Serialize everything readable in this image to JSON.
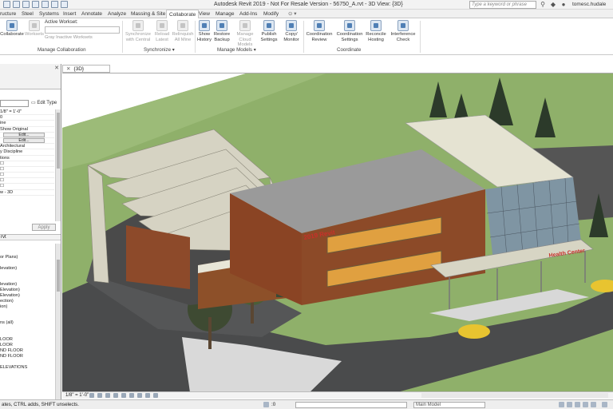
{
  "titlebar": {
    "title": "Autodesk Revit 2019 - Not For Resale Version - 56750_A.rvt - 3D View: {3D}",
    "search_placeholder": "Type a keyword or phrase",
    "user": "tomesc.hudale"
  },
  "tabs": [
    {
      "label": "ructure"
    },
    {
      "label": "Steel"
    },
    {
      "label": "Systems"
    },
    {
      "label": "Insert"
    },
    {
      "label": "Annotate"
    },
    {
      "label": "Analyze"
    },
    {
      "label": "Massing & Site"
    },
    {
      "label": "Collaborate"
    },
    {
      "label": "View"
    },
    {
      "label": "Manage"
    },
    {
      "label": "Add-Ins"
    },
    {
      "label": "Modify"
    }
  ],
  "ribbon": {
    "collaborate_label": "Collaborate",
    "worksets_label": "Worksets",
    "active_workset_label": "Active Workset:",
    "gray_inactive_label": "Gray Inactive Worksets",
    "manage_collab_label": "Manage Collaboration",
    "synchronize": {
      "sync_central": "Synchronize with Central",
      "reload_latest": "Reload Latest",
      "relinquish_all": "Relinquish All Mine",
      "panel": "Synchronize ▾"
    },
    "manage_models": {
      "show_history": "Show History",
      "restore_backup": "Restore Backup",
      "manage_cloud": "Manage Cloud Models",
      "publish_settings": "Publish Settings",
      "copy_monitor": "Copy/ Monitor",
      "panel": "Manage Models ▾"
    },
    "coordinate": {
      "coord_review": "Coordination Review",
      "coord_settings": "Coordination Settings",
      "reconcile": "Reconcile Hosting",
      "interference": "Interference Check",
      "panel": "Coordinate"
    }
  },
  "properties": {
    "edit_type": "Edit Type",
    "rows": [
      "1/8\" = 1'-0\"",
      "0",
      "ine",
      "Show Original",
      "Edit...",
      "Edit...",
      "Architectural",
      "y Discipline",
      "tions",
      "",
      "",
      "",
      "",
      "",
      "w - 3D"
    ],
    "apply": "Apply"
  },
  "browser": {
    "header": "rvt",
    "rows": [
      "",
      "",
      "or Plans)",
      "",
      "levation)",
      "",
      "",
      "levation)",
      "Elevation)",
      "Elevation)",
      "ection)",
      "ion)",
      "",
      "",
      "ns (all)",
      "",
      "",
      "LOOR",
      "LOOR",
      "ND FLOOR",
      "ND FLOOR",
      "",
      "ELEVATIONS",
      ""
    ]
  },
  "view": {
    "tab_label": "{3D}",
    "scale": "1/8\" = 1'-0\""
  },
  "building": {
    "sign_left": "2019 Revit",
    "sign_right": "Health Center"
  },
  "statusbar": {
    "text": "ates, CTRL adds, SHIFT unselects.",
    "model": "Main Model",
    "workset_zero": ":0"
  }
}
